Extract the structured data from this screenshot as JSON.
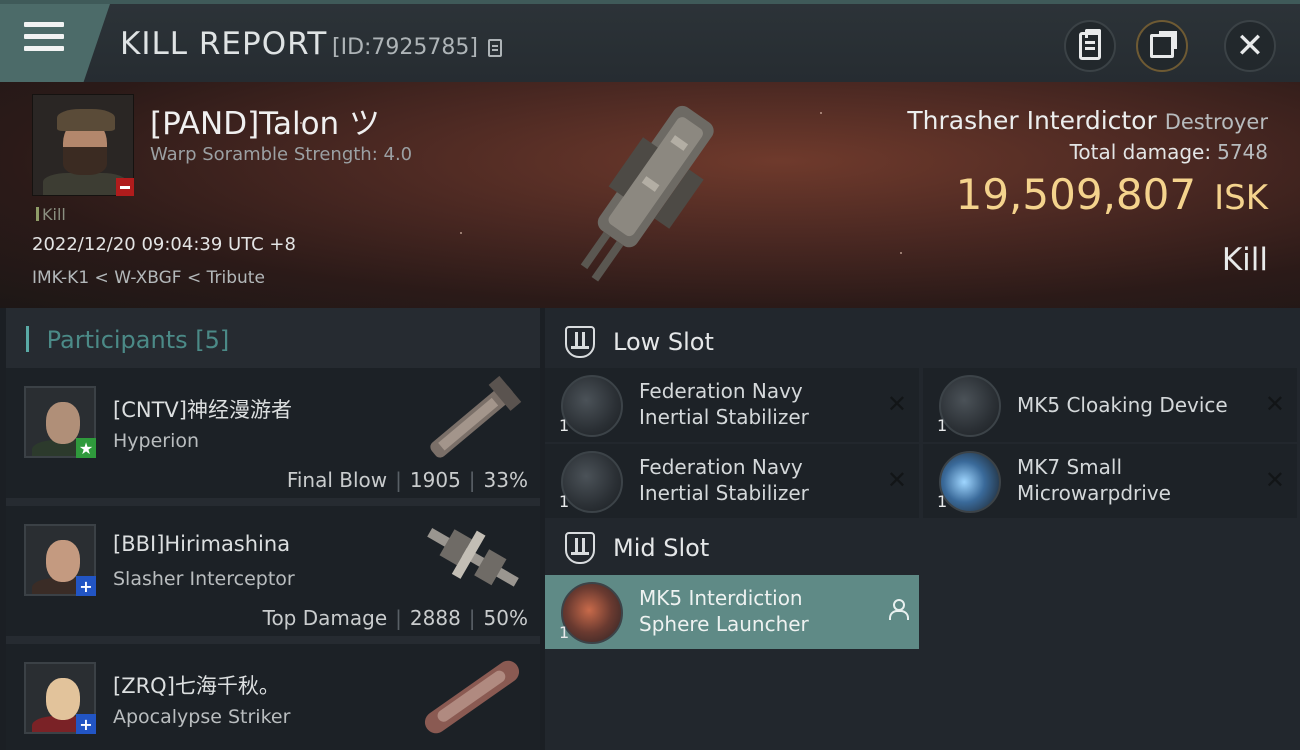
{
  "header": {
    "title": "KILL REPORT",
    "report_id": "[ID:7925785]"
  },
  "victim": {
    "pilot_name": "[PAND]Talon ツ",
    "warp_scramble": "Warp Soramble Strength: 4.0",
    "kill_tag": "Kill",
    "datetime": "2022/12/20 09:04:39 UTC +8",
    "location": "IMK-K1 < W-XBGF < Tribute",
    "ship_name": "Thrasher Interdictor",
    "ship_class": "Destroyer",
    "total_damage_label": "Total damage:",
    "total_damage": "5748",
    "isk_value": "19,509,807",
    "isk_unit": "ISK",
    "result": "Kill"
  },
  "participants": {
    "label": "Participants",
    "count": "[5]",
    "items": [
      {
        "name": "[CNTV]神经漫游者",
        "ship": "Hyperion",
        "role": "Final Blow",
        "damage": "1905",
        "percent": "33%",
        "badge": "★",
        "badge_color": "#2f9a3c"
      },
      {
        "name": "[BBI]Hirimashina",
        "ship": "Slasher Interceptor",
        "role": "Top Damage",
        "damage": "2888",
        "percent": "50%",
        "badge": "+",
        "badge_color": "#2255c4"
      },
      {
        "name": "[ZRQ]七海千秋。",
        "ship": "Apocalypse Striker",
        "role": "",
        "damage": "",
        "percent": "",
        "badge": "+",
        "badge_color": "#2255c4"
      }
    ]
  },
  "slots": {
    "low": {
      "title": "Low Slot",
      "modules": [
        {
          "name": "Federation Navy Inertial Stabilizer",
          "qty": "1",
          "icon": "inertial-stabilizer-icon"
        },
        {
          "name": "MK5 Cloaking Device",
          "qty": "1",
          "icon": "cloaking-device-icon"
        },
        {
          "name": "Federation Navy Inertial Stabilizer",
          "qty": "1",
          "icon": "inertial-stabilizer-icon"
        },
        {
          "name": "MK7 Small Microwarpdrive",
          "qty": "1",
          "icon": "microwarpdrive-icon"
        }
      ]
    },
    "mid": {
      "title": "Mid Slot",
      "modules": [
        {
          "name": "MK5 Interdiction Sphere Launcher",
          "qty": "1",
          "icon": "sphere-launcher-icon"
        }
      ]
    }
  },
  "colors": {
    "accent": "#5f8a86",
    "isk": "#f4d38d",
    "participants_header": "#4b8a87"
  }
}
